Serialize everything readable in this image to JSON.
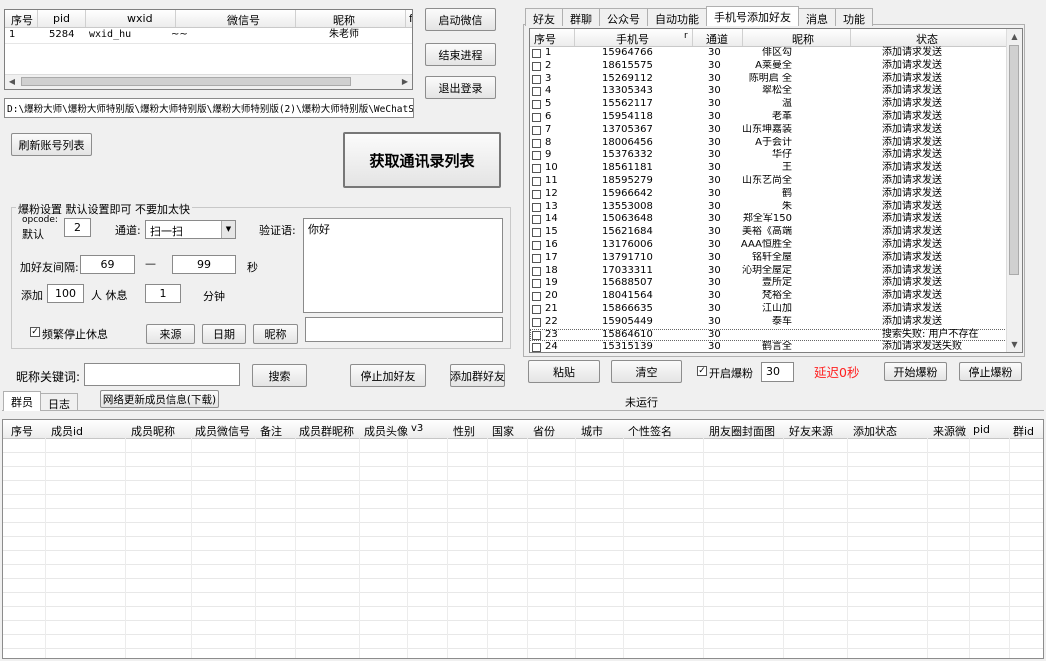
{
  "account_table": {
    "headers": [
      "序号",
      "pid",
      "wxid",
      "微信号",
      "昵称",
      "fi"
    ],
    "rows": [
      [
        "1",
        "5284",
        "wxid_hu",
        "~~",
        "朱老师"
      ]
    ]
  },
  "path": "D:\\爆粉大师\\爆粉大师特别版\\爆粉大师特别版\\爆粉大师特别版(2)\\爆粉大师特别版\\WeChatStor",
  "buttons": {
    "start_wechat": "启动微信",
    "end_process": "结束进程",
    "logout": "退出登录",
    "refresh_accounts": "刷新账号列表",
    "get_contacts": "获取通讯录列表",
    "source": "来源",
    "date": "日期",
    "nickname": "昵称",
    "search": "搜索",
    "stop_add_friend": "停止加好友",
    "add_group_friend": "添加群好友",
    "download_members": "网络更新成员信息(下载)",
    "paste": "粘贴",
    "clear": "清空",
    "start_fan": "开始爆粉",
    "stop_fan": "停止爆粉"
  },
  "settings": {
    "title": "爆粉设置  默认设置即可   不要加太快",
    "opcode_label": "opcode:",
    "default_label": "默认",
    "opcode_value": "2",
    "channel_label": "通道:",
    "channel_value": "扫一扫",
    "verify_label": "验证语:",
    "verify_value": "你好",
    "interval_label": "加好友间隔:",
    "interval_min": "69",
    "dash": "—",
    "interval_max": "99",
    "seconds": "秒",
    "add_label": "添加",
    "add_count": "100",
    "person_rest": "人  休息",
    "rest_value": "1",
    "minutes": "分钟",
    "frequent_rest": "频繁停止休息"
  },
  "keyword": {
    "label": "昵称关键词:",
    "value": ""
  },
  "bottom_tabs": [
    "群员",
    "日志"
  ],
  "status_text": "未运行",
  "right_tabs": [
    "好友",
    "群聊",
    "公众号",
    "自动功能",
    "手机号添加好友",
    "消息",
    "功能"
  ],
  "right_active_tab": 4,
  "phone_table": {
    "headers": [
      "序号",
      "手机号",
      "r",
      "通道",
      "昵称",
      "状态"
    ],
    "rows": [
      [
        "1",
        "15964766",
        "30",
        "俳区勾",
        "添加请求发送"
      ],
      [
        "2",
        "18615575",
        "30",
        "A莱曼全",
        "添加请求发送"
      ],
      [
        "3",
        "15269112",
        "30",
        "陈明启 全",
        "添加请求发送"
      ],
      [
        "4",
        "13305343",
        "30",
        "翠松全",
        "添加请求发送"
      ],
      [
        "5",
        "15562117",
        "30",
        "温",
        "添加请求发送"
      ],
      [
        "6",
        "15954118",
        "30",
        "老革",
        "添加请求发送"
      ],
      [
        "7",
        "13705367",
        "30",
        "山东坤嘉装",
        "添加请求发送"
      ],
      [
        "8",
        "18006456",
        "30",
        "A于会计",
        "添加请求发送"
      ],
      [
        "9",
        "15376332",
        "30",
        "华仔",
        "添加请求发送"
      ],
      [
        "10",
        "18561181",
        "30",
        "王",
        "添加请求发送"
      ],
      [
        "11",
        "18595279",
        "30",
        "山东艺尚全",
        "添加请求发送"
      ],
      [
        "12",
        "15966642",
        "30",
        "鹤",
        "添加请求发送"
      ],
      [
        "13",
        "13553008",
        "30",
        "朱",
        "添加请求发送"
      ],
      [
        "14",
        "15063648",
        "30",
        "郑全军150",
        "添加请求发送"
      ],
      [
        "15",
        "15621684",
        "30",
        "美裕《高端",
        "添加请求发送"
      ],
      [
        "16",
        "13176006",
        "30",
        "AAA恒胜全",
        "添加请求发送"
      ],
      [
        "17",
        "13791710",
        "30",
        "铭轩全屋",
        "添加请求发送"
      ],
      [
        "18",
        "17033311",
        "30",
        "沁玥全屋定",
        "添加请求发送"
      ],
      [
        "19",
        "15688507",
        "30",
        "壹所定",
        "添加请求发送"
      ],
      [
        "20",
        "18041564",
        "30",
        "梵裕全",
        "添加请求发送"
      ],
      [
        "21",
        "15866635",
        "30",
        "江山加",
        "添加请求发送"
      ],
      [
        "22",
        "15905449",
        "30",
        "泰车",
        "添加请求发送"
      ],
      [
        "23",
        "15864610",
        "30",
        "",
        "搜索失败: 用户不存在"
      ],
      [
        "24",
        "15315139",
        "30",
        "鹤言全",
        "添加请求发送失败"
      ]
    ]
  },
  "auto_fan": {
    "label": "开启爆粉",
    "value": "30",
    "delay": "延迟0秒"
  },
  "member_table": {
    "headers": [
      "序号",
      "成员id",
      "成员昵称",
      "成员微信号",
      "备注",
      "成员群昵称",
      "成员头像",
      "v3",
      "性别",
      "国家",
      "省份",
      "城市",
      "个性签名",
      "朋友圈封面图",
      "好友来源",
      "添加状态",
      "来源微",
      "pid",
      "群id"
    ]
  }
}
